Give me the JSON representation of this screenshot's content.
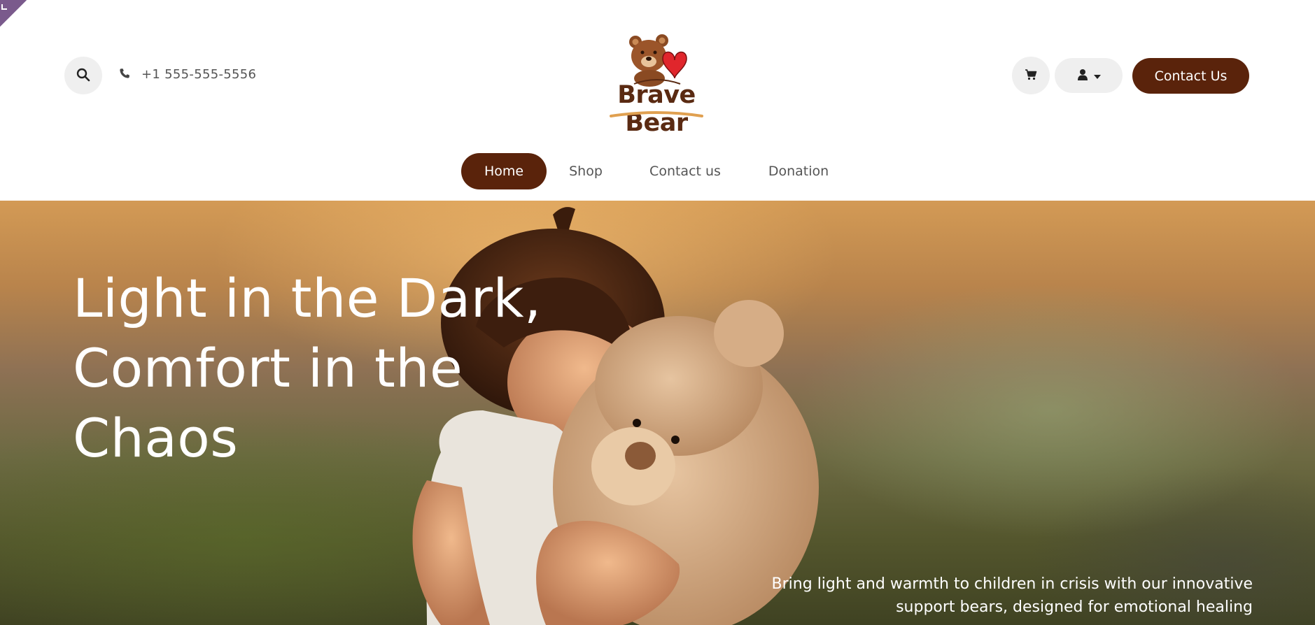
{
  "header": {
    "phone": "+1 555-555-5556",
    "logo_text": "Brave Bear",
    "contact_button": "Contact Us",
    "icons": {
      "search": "search-icon",
      "phone": "phone-icon",
      "cart": "cart-icon",
      "user": "user-icon",
      "caret": "chevron-down-icon"
    }
  },
  "nav": {
    "items": [
      {
        "label": "Home",
        "active": true
      },
      {
        "label": "Shop",
        "active": false
      },
      {
        "label": "Contact us",
        "active": false
      },
      {
        "label": "Donation",
        "active": false
      }
    ]
  },
  "hero": {
    "title": "Light in the Dark,\nComfort in the\nChaos",
    "subtitle": "Bring light and warmth to children in crisis with our innovative support bears, designed for emotional healing"
  },
  "colors": {
    "brand": "#5a230b",
    "button_bg": "#efefef",
    "heart": "#e0262c"
  }
}
